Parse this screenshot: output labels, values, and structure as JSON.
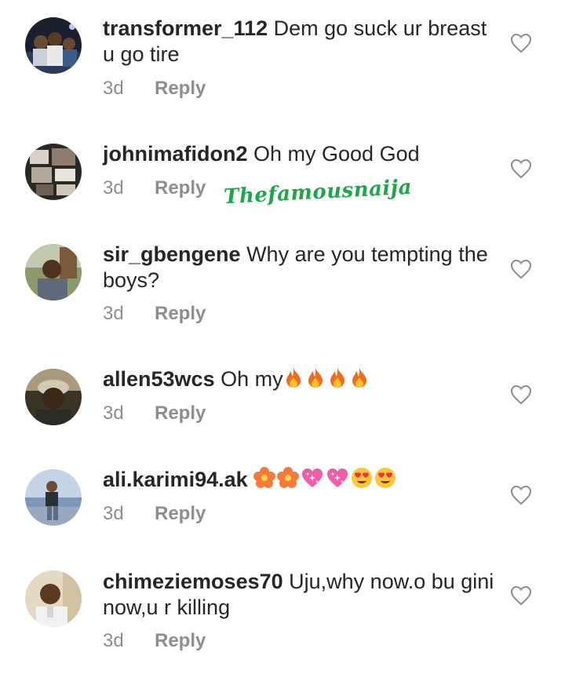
{
  "comments": [
    {
      "username": "transformer_112",
      "text": "Dem go suck ur breast u go tire",
      "time": "3d",
      "reply": "Reply"
    },
    {
      "username": "johnimafidon2",
      "text": "Oh my Good God",
      "time": "3d",
      "reply": "Reply"
    },
    {
      "username": "sir_gbengene",
      "text": "Why are you tempting the boys?",
      "time": "3d",
      "reply": "Reply"
    },
    {
      "username": "allen53wcs",
      "text": "Oh my",
      "emojis": [
        "fire-emoji",
        "fire-emoji",
        "fire-emoji",
        "fire-emoji"
      ],
      "time": "3d",
      "reply": "Reply"
    },
    {
      "username": "ali.karimi94.ak",
      "text": "",
      "emojis": [
        "flower-emoji",
        "flower-emoji",
        "sparkling-heart-emoji",
        "sparkling-heart-emoji",
        "heart-eyes-emoji",
        "heart-eyes-emoji"
      ],
      "time": "3d",
      "reply": "Reply"
    },
    {
      "username": "chimeziemoses70",
      "text": "Uju,why now.o bu gini now,u r killing",
      "time": "3d",
      "reply": "Reply"
    }
  ],
  "watermark": "Thefamousnaija",
  "colors": {
    "text": "#262626",
    "meta": "#8e8e8e",
    "watermark": "#1fa64a",
    "heart_outline": "#8e8e8e"
  }
}
